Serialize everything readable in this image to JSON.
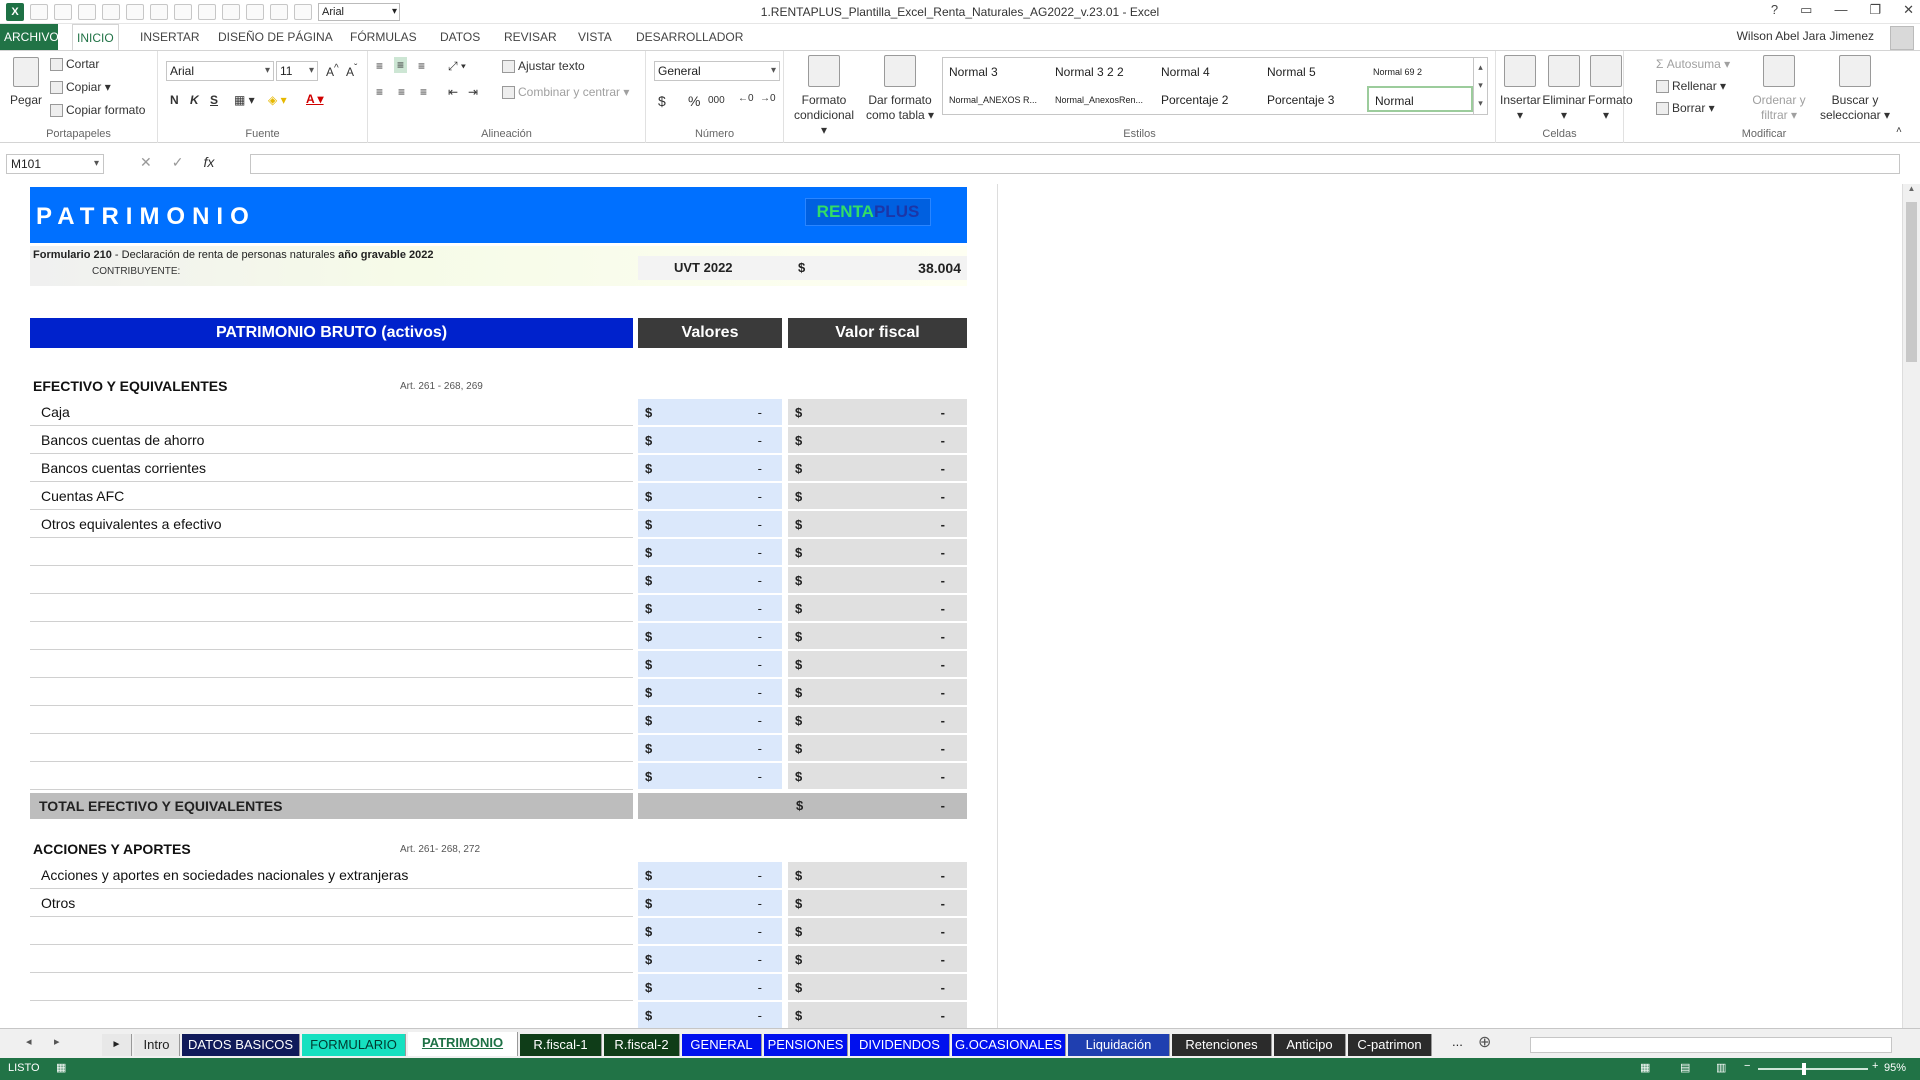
{
  "window": {
    "title": "1.RENTAPLUS_Plantilla_Excel_Renta_Naturales_AG2022_v.23.01 - Excel",
    "qat_font": "Arial",
    "help": "?"
  },
  "tabs": [
    "ARCHIVO",
    "INICIO",
    "INSERTAR",
    "DISEÑO DE PÁGINA",
    "FÓRMULAS",
    "DATOS",
    "REVISAR",
    "VISTA",
    "DESARROLLADOR"
  ],
  "user": "Wilson Abel Jara Jimenez",
  "ribbon": {
    "clipboard": {
      "paste": "Pegar",
      "cut": "Cortar",
      "copy": "Copiar",
      "format_painter": "Copiar formato",
      "label": "Portapapeles"
    },
    "font": {
      "name": "Arial",
      "size": "11",
      "label": "Fuente",
      "bold": "N",
      "italic": "K",
      "underline": "S"
    },
    "alignment": {
      "wrap": "Ajustar texto",
      "merge": "Combinar y centrar",
      "label": "Alineación"
    },
    "number": {
      "format": "General",
      "label": "Número",
      "currency": "$",
      "percent": "%",
      "thousands": "000"
    },
    "styles": {
      "cond_format": [
        "Formato",
        "condicional"
      ],
      "table_format": [
        "Dar formato",
        "como tabla"
      ],
      "label": "Estilos",
      "items": [
        "Normal 3",
        "Normal 3 2 2",
        "Normal 4",
        "Normal 5",
        "Normal 69 2",
        "Normal_ANEXOS R...",
        "Normal_AnexosRen...",
        "Porcentaje 2",
        "Porcentaje 3",
        "Normal"
      ]
    },
    "cells": {
      "insert": "Insertar",
      "delete": "Eliminar",
      "format": "Formato",
      "label": "Celdas"
    },
    "editing": {
      "autosum": "Autosuma",
      "fill": "Rellenar",
      "clear": "Borrar",
      "sort": [
        "Ordenar y",
        "filtrar"
      ],
      "find": [
        "Buscar y",
        "seleccionar"
      ],
      "label": "Modificar"
    }
  },
  "formula_bar": {
    "name_box": "M101",
    "fx": "fx",
    "value": ""
  },
  "sheet": {
    "banner_title": "PATRIMONIO",
    "logo": {
      "a": "RENTA",
      "b": "PLUS"
    },
    "form_line": {
      "bold1": "Formulario 210",
      "text": " - Declaración de renta de personas naturales ",
      "bold2": "año gravable 2022"
    },
    "contribuyente": "CONTRIBUYENTE:",
    "uvt_label": "UVT 2022",
    "uvt_currency": "$",
    "uvt_value": "38.004",
    "header_bruto": "PATRIMONIO BRUTO (activos)",
    "header_valores": "Valores",
    "header_fiscal": "Valor fiscal",
    "section1": {
      "title": "EFECTIVO Y EQUIVALENTES",
      "art": "Art. 261 - 268, 269",
      "rows": [
        "Caja",
        "Bancos cuentas de ahorro",
        "Bancos cuentas corrientes",
        "Cuentas AFC",
        "Otros equivalentes a efectivo",
        "",
        "",
        "",
        "",
        "",
        "",
        "",
        "",
        ""
      ]
    },
    "total1": {
      "label": "TOTAL EFECTIVO Y EQUIVALENTES",
      "currency": "$",
      "value": "-"
    },
    "section2": {
      "title": "ACCIONES Y APORTES",
      "art": "Art. 261- 268, 272",
      "rows": [
        "Acciones y aportes en sociedades nacionales y extranjeras",
        "Otros",
        "",
        "",
        "",
        ""
      ]
    },
    "cell_currency": "$",
    "cell_empty": "-"
  },
  "sheet_tabs": [
    {
      "label": "Intro",
      "bg": "#e8e8e8",
      "fg": "#222"
    },
    {
      "label": "DATOS BASICOS",
      "bg": "#101a5a",
      "fg": "#ffffff"
    },
    {
      "label": "FORMULARIO",
      "bg": "#16e0c0",
      "fg": "#003a30"
    },
    {
      "label": "PATRIMONIO",
      "bg": "#ffffff",
      "fg": "#1e7145",
      "active": true
    },
    {
      "label": "R.fiscal-1",
      "bg": "#0f3d18",
      "fg": "#ffffff"
    },
    {
      "label": "R.fiscal-2",
      "bg": "#0f3d18",
      "fg": "#ffffff"
    },
    {
      "label": "GENERAL",
      "bg": "#0010ee",
      "fg": "#ffffff"
    },
    {
      "label": "PENSIONES",
      "bg": "#0010ee",
      "fg": "#ffffff"
    },
    {
      "label": "DIVIDENDOS",
      "bg": "#0010ee",
      "fg": "#ffffff"
    },
    {
      "label": "G.OCASIONALES",
      "bg": "#0010ee",
      "fg": "#ffffff"
    },
    {
      "label": "Liquidación",
      "bg": "#1f3fb0",
      "fg": "#ffffff"
    },
    {
      "label": "Retenciones",
      "bg": "#2b2b2b",
      "fg": "#ffffff"
    },
    {
      "label": "Anticipo",
      "bg": "#2b2b2b",
      "fg": "#ffffff"
    },
    {
      "label": "C-patrimon",
      "bg": "#2b2b2b",
      "fg": "#ffffff"
    }
  ],
  "tab_more": "...",
  "status": {
    "mode": "LISTO",
    "zoom": "95%"
  },
  "colors": {
    "excel_green": "#217346",
    "header_blue": "#0022cc",
    "banner_blue": "#0070ff",
    "cell_blue": "#dbe8fb",
    "cell_grey": "#e0e0e0"
  }
}
